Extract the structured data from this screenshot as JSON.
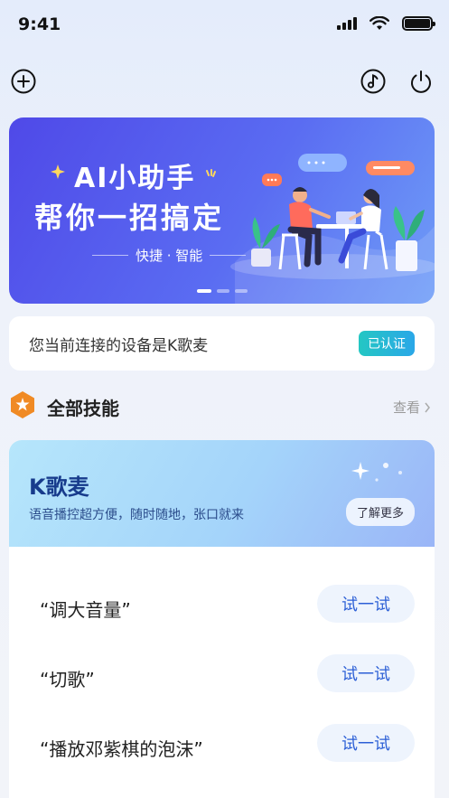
{
  "status_bar": {
    "time": "9:41"
  },
  "toolbar": {
    "add_icon": "plus-circle-icon",
    "music_icon": "music-note-icon",
    "power_icon": "power-icon"
  },
  "banner": {
    "title_line1": "AI小助手",
    "title_line2": "帮你一招搞定",
    "subtitle": "快捷 · 智能",
    "page_count": 3,
    "active_page": 1
  },
  "device": {
    "text": "您当前连接的设备是K歌麦",
    "badge": "已认证"
  },
  "skills": {
    "title": "全部技能",
    "view_more": "查看",
    "card": {
      "name": "K歌麦",
      "description": "语音播控超方便，随时随地，张口就来",
      "learn_more": "了解更多",
      "commands": [
        {
          "phrase": "“调大音量”",
          "action": "试一试"
        },
        {
          "phrase": "“切歌”",
          "action": "试一试"
        },
        {
          "phrase": "“播放邓紫棋的泡沫”",
          "action": "试一试"
        }
      ]
    }
  },
  "colors": {
    "accent_blue": "#2c5fd6",
    "banner_start": "#4f49e8",
    "badge_teal": "#24c7c3",
    "skills_orange": "#f08a24"
  }
}
